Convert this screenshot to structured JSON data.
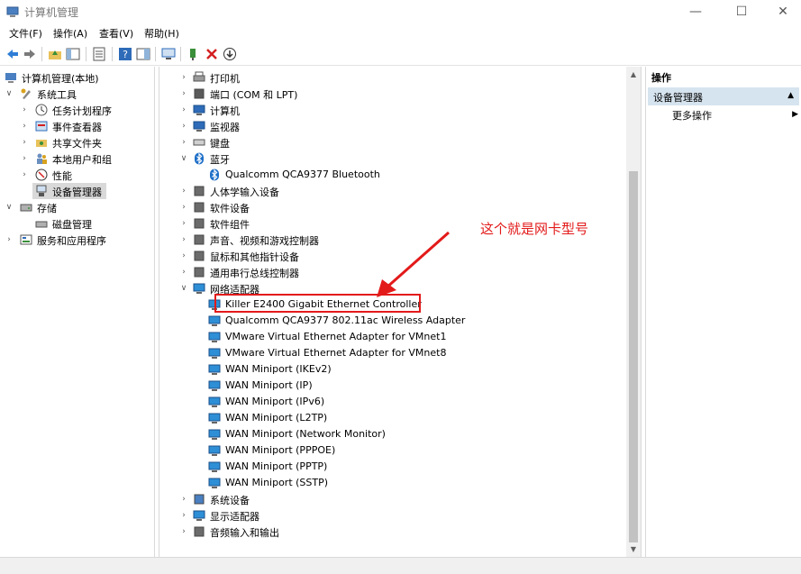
{
  "window": {
    "title": "计算机管理"
  },
  "menu": [
    "文件(F)",
    "操作(A)",
    "查看(V)",
    "帮助(H)"
  ],
  "left_tree": [
    {
      "label": "计算机管理(本地)",
      "icon": "computer-management-icon"
    },
    {
      "label": "系统工具",
      "icon": "tools-icon"
    },
    {
      "label": "任务计划程序",
      "icon": "clock-icon"
    },
    {
      "label": "事件查看器",
      "icon": "event-viewer-icon"
    },
    {
      "label": "共享文件夹",
      "icon": "shared-folder-icon"
    },
    {
      "label": "本地用户和组",
      "icon": "users-icon"
    },
    {
      "label": "性能",
      "icon": "performance-icon"
    },
    {
      "label": "设备管理器",
      "icon": "device-manager-icon"
    },
    {
      "label": "存储",
      "icon": "storage-icon"
    },
    {
      "label": "磁盘管理",
      "icon": "disk-icon"
    },
    {
      "label": "服务和应用程序",
      "icon": "services-icon"
    }
  ],
  "device_tree": [
    {
      "label": "打印机",
      "icon": "printer-icon"
    },
    {
      "label": "端口 (COM 和 LPT)",
      "icon": "port-icon"
    },
    {
      "label": "计算机",
      "icon": "computer-icon"
    },
    {
      "label": "监视器",
      "icon": "monitor-icon"
    },
    {
      "label": "键盘",
      "icon": "keyboard-icon"
    },
    {
      "label": "蓝牙",
      "icon": "bluetooth-icon"
    },
    {
      "label": "Qualcomm QCA9377 Bluetooth",
      "icon": "bluetooth-device-icon"
    },
    {
      "label": "人体学输入设备",
      "icon": "hid-icon"
    },
    {
      "label": "软件设备",
      "icon": "software-device-icon"
    },
    {
      "label": "软件组件",
      "icon": "software-component-icon"
    },
    {
      "label": "声音、视频和游戏控制器",
      "icon": "sound-icon"
    },
    {
      "label": "鼠标和其他指针设备",
      "icon": "mouse-icon"
    },
    {
      "label": "通用串行总线控制器",
      "icon": "usb-icon"
    },
    {
      "label": "网络适配器",
      "icon": "network-adapter-icon"
    },
    {
      "label": "Killer E2400 Gigabit Ethernet Controller",
      "icon": "network-adapter-icon"
    },
    {
      "label": "Qualcomm QCA9377 802.11ac Wireless Adapter",
      "icon": "network-adapter-icon"
    },
    {
      "label": "VMware Virtual Ethernet Adapter for VMnet1",
      "icon": "network-adapter-icon"
    },
    {
      "label": "VMware Virtual Ethernet Adapter for VMnet8",
      "icon": "network-adapter-icon"
    },
    {
      "label": "WAN Miniport (IKEv2)",
      "icon": "network-adapter-icon"
    },
    {
      "label": "WAN Miniport (IP)",
      "icon": "network-adapter-icon"
    },
    {
      "label": "WAN Miniport (IPv6)",
      "icon": "network-adapter-icon"
    },
    {
      "label": "WAN Miniport (L2TP)",
      "icon": "network-adapter-icon"
    },
    {
      "label": "WAN Miniport (Network Monitor)",
      "icon": "network-adapter-icon"
    },
    {
      "label": "WAN Miniport (PPPOE)",
      "icon": "network-adapter-icon"
    },
    {
      "label": "WAN Miniport (PPTP)",
      "icon": "network-adapter-icon"
    },
    {
      "label": "WAN Miniport (SSTP)",
      "icon": "network-adapter-icon"
    },
    {
      "label": "系统设备",
      "icon": "system-device-icon"
    },
    {
      "label": "显示适配器",
      "icon": "display-adapter-icon"
    },
    {
      "label": "音频输入和输出",
      "icon": "audio-icon"
    }
  ],
  "actions": {
    "header": "操作",
    "section": "设备管理器",
    "more": "更多操作"
  },
  "annotation": {
    "text": "这个就是网卡型号",
    "color": "#e31a1a"
  },
  "colors": {
    "accent": "#1e6fc8",
    "selection": "#d9d9d9",
    "annotation": "#e31a1a"
  }
}
